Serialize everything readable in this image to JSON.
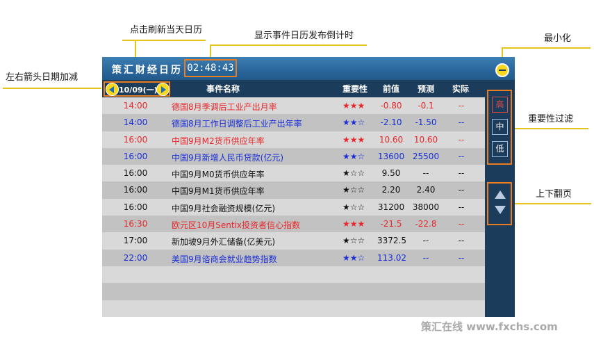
{
  "annotations": {
    "click_refresh": "点击刷新当天日历",
    "countdown_desc": "显示事件日历发布倒计时",
    "minimize": "最小化",
    "arrows_desc": "左右箭头日期加减",
    "importance_filter": "重要性过滤",
    "page_turn": "上下翻页"
  },
  "app": {
    "title": "策汇财经日历",
    "countdown": "02:48:43",
    "date": "10/09(一)"
  },
  "columns": {
    "name": "事件名称",
    "importance": "重要性",
    "previous": "前值",
    "forecast": "预测",
    "actual": "实际"
  },
  "filters": {
    "high": "高",
    "medium": "中",
    "low": "低"
  },
  "colors": {
    "high": "#e8272a",
    "medium": "#1a2fd8",
    "low": "#111111"
  },
  "events": [
    {
      "time": "14:00",
      "name": "德国8月季调后工业产出月率",
      "stars": "★★★",
      "previous": "-0.80",
      "forecast": "-0.1",
      "actual": "--",
      "level": "high"
    },
    {
      "time": "14:00",
      "name": "德国8月工作日调整后工业产出年率",
      "stars": "★★☆",
      "previous": "-2.10",
      "forecast": "-1.50",
      "actual": "--",
      "level": "medium"
    },
    {
      "time": "16:00",
      "name": "中国9月M2货币供应年率",
      "stars": "★★★",
      "previous": "10.60",
      "forecast": "10.60",
      "actual": "--",
      "level": "high"
    },
    {
      "time": "16:00",
      "name": "中国9月新增人民币贷款(亿元)",
      "stars": "★★☆",
      "previous": "13600",
      "forecast": "25500",
      "actual": "--",
      "level": "medium"
    },
    {
      "time": "16:00",
      "name": "中国9月M0货币供应年率",
      "stars": "★☆☆",
      "previous": "9.50",
      "forecast": "--",
      "actual": "--",
      "level": "low"
    },
    {
      "time": "16:00",
      "name": "中国9月M1货币供应年率",
      "stars": "★☆☆",
      "previous": "2.20",
      "forecast": "2.40",
      "actual": "--",
      "level": "low"
    },
    {
      "time": "16:00",
      "name": "中国9月社会融资规模(亿元)",
      "stars": "★☆☆",
      "previous": "31200",
      "forecast": "38000",
      "actual": "--",
      "level": "low"
    },
    {
      "time": "16:30",
      "name": "欧元区10月Sentix投资者信心指数",
      "stars": "★★★",
      "previous": "-21.5",
      "forecast": "-22.8",
      "actual": "--",
      "level": "high"
    },
    {
      "time": "17:00",
      "name": "新加坡9月外汇储备(亿美元)",
      "stars": "★☆☆",
      "previous": "3372.5",
      "forecast": "--",
      "actual": "--",
      "level": "low"
    },
    {
      "time": "22:00",
      "name": "美国9月谘商会就业趋势指数",
      "stars": "★★☆",
      "previous": "113.02",
      "forecast": "--",
      "actual": "--",
      "level": "medium"
    }
  ],
  "watermark": "策汇在线 www.fxchs.com"
}
